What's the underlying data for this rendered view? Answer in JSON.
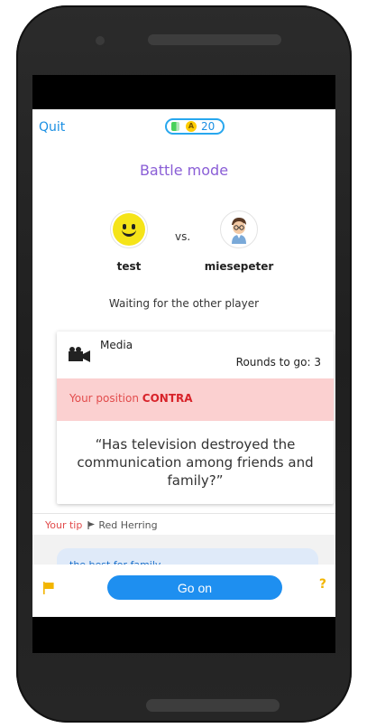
{
  "header": {
    "quit_label": "Quit",
    "coins": "20",
    "coin_symbol": "A"
  },
  "screen_title": "Battle mode",
  "players": {
    "left": "test",
    "vs": "vs.",
    "right": "miesepeter"
  },
  "status_text": "Waiting for the other player",
  "card": {
    "category": "Media",
    "rounds_label": "Rounds to go: 3",
    "position_label": "Your position ",
    "position_value": "CONTRA",
    "question": "“Has television destroyed the communication among friends and family?”"
  },
  "tip": {
    "label": "Your tip",
    "value": "Red Herring"
  },
  "bubble_text": "the best for family",
  "bottom": {
    "go_on_label": "Go on",
    "help_label": "?"
  },
  "colors": {
    "accent": "#1e8ff0",
    "title": "#8a5ed6",
    "position_bg": "#fbd0d0",
    "contra": "#d8232a"
  },
  "icons": [
    "camera-icon",
    "flag-icon",
    "coin-icon",
    "smiley-avatar-icon",
    "boy-avatar-icon",
    "pennant-icon"
  ]
}
